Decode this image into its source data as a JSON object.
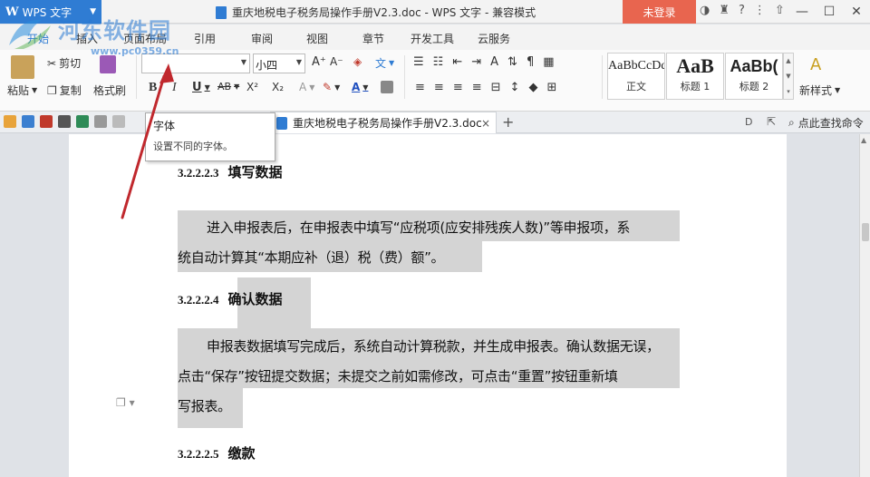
{
  "titlebar": {
    "app_name": "WPS 文字",
    "doc_title": "重庆地税电子税务局操作手册V2.3.doc - WPS 文字 - 兼容模式",
    "login": "未登录",
    "help": "?"
  },
  "menu": {
    "tabs": [
      "开始",
      "插入",
      "页面布局",
      "引用",
      "审阅",
      "视图",
      "章节",
      "开发工具",
      "云服务"
    ]
  },
  "ribbon": {
    "cut": "剪切",
    "paste": "粘贴",
    "copy": "复制",
    "format_painter": "格式刷",
    "font_value": "",
    "font_size": "小四",
    "bold": "B",
    "italic": "I",
    "underline": "U",
    "strike": "AB",
    "superscript": "X²",
    "subscript": "X₂",
    "styles": [
      {
        "sample": "AaBbCcDd",
        "label": "正文"
      },
      {
        "sample": "AaB",
        "label": "标题 1"
      },
      {
        "sample": "AaBb(",
        "label": "标题 2"
      }
    ],
    "new_style": "新样式"
  },
  "docbar": {
    "tab_title": "重庆地税电子税务局操作手册V2.3.doc",
    "close": "×",
    "add": "+",
    "search": "点此查找命令"
  },
  "tooltip": {
    "title": "字体",
    "desc": "设置不同的字体。"
  },
  "document": {
    "h1_num": "3.2.2.2.3",
    "h1_text": "填写数据",
    "p1_l1": "进入申报表后，在申报表中填写“应税项(应安排残疾人数)”等申报项，系",
    "p1_l2": "统自动计算其“本期应补（退）税（费）额”。",
    "h2_num": "3.2.2.2.4",
    "h2_text": "确认数据",
    "p2_l1": "申报表数据填写完成后，系统自动计算税款，并生成申报表。确认数据无误，",
    "p2_l2": "点击“保存”按钮提交数据；未提交之前如需修改，可点击“重置”按钮重新填",
    "p2_l3": "写报表。",
    "h3_num": "3.2.2.2.5",
    "h3_text": "缴款"
  },
  "watermark": {
    "name": "河东软件园",
    "url": "www.pc0359.cn"
  },
  "colors": {
    "accent": "#2f7cd3",
    "login": "#e8654f",
    "highlight": "#d4d4d4",
    "arrow": "#c0282d"
  }
}
